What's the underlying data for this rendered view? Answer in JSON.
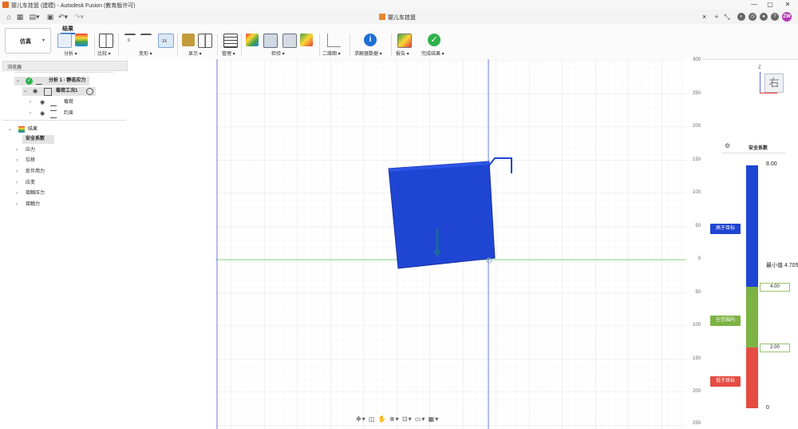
{
  "window": {
    "title": "婴儿车挂篮 (建模) - Autodesk Fusion (教育版许可)",
    "controls": [
      "—",
      "▢",
      "✕"
    ]
  },
  "tab": {
    "title": "婴儿车挂篮",
    "close": "×",
    "add": "+"
  },
  "user": {
    "initials": "ZW",
    "avatar_color": "#b53cb1"
  },
  "ribbon": {
    "workspace": "仿真",
    "active_tab": "结果",
    "groups": [
      {
        "label": "分析",
        "icon": "analysis-icon"
      },
      {
        "label": "比较",
        "icon": "compare-icon"
      },
      {
        "label": "变形",
        "icon": "deform-icon"
      },
      {
        "label": "显示",
        "icon": "display-icon"
      },
      {
        "label": "管理",
        "icon": "manage-icon"
      },
      {
        "label": "检验",
        "icon": "inspect-icon"
      },
      {
        "label": "二维图",
        "icon": "2d-plot-icon"
      },
      {
        "label": "求解器数据",
        "icon": "solver-data-icon"
      },
      {
        "label": "报告",
        "icon": "report-icon"
      },
      {
        "label": "完成结果",
        "icon": "finish-results-icon"
      }
    ],
    "deform_values": [
      "0",
      "",
      "1X"
    ]
  },
  "browser": {
    "title": "浏览器",
    "tree": {
      "study": "分析 1 - 静态应力",
      "load_case": "载荷工况1",
      "loads": "载荷",
      "constraints": "约束",
      "results": "结果",
      "result_items": [
        "安全系数",
        "应力",
        "位移",
        "反作用力",
        "应变",
        "接触压力",
        "接触力"
      ]
    }
  },
  "viewport": {
    "ruler_ticks": [
      "300",
      "250",
      "200",
      "150",
      "100",
      "50",
      "0",
      "50",
      "100",
      "150",
      "200",
      "250"
    ],
    "viewcube_face": "右",
    "viewcube_axis": "Z",
    "part_color": "#1f45d3"
  },
  "legend": {
    "title": "安全系数",
    "max": "8.00",
    "min_label": "最小值 4.705",
    "threshold_high": "4.00",
    "threshold_low": "2.00",
    "zero": "0",
    "above_label": "高于目标",
    "within_label": "在范围内",
    "below_label": "低于目标",
    "colors": {
      "above": "#1f45d3",
      "within": "#7cb342",
      "below": "#e54c42"
    }
  }
}
